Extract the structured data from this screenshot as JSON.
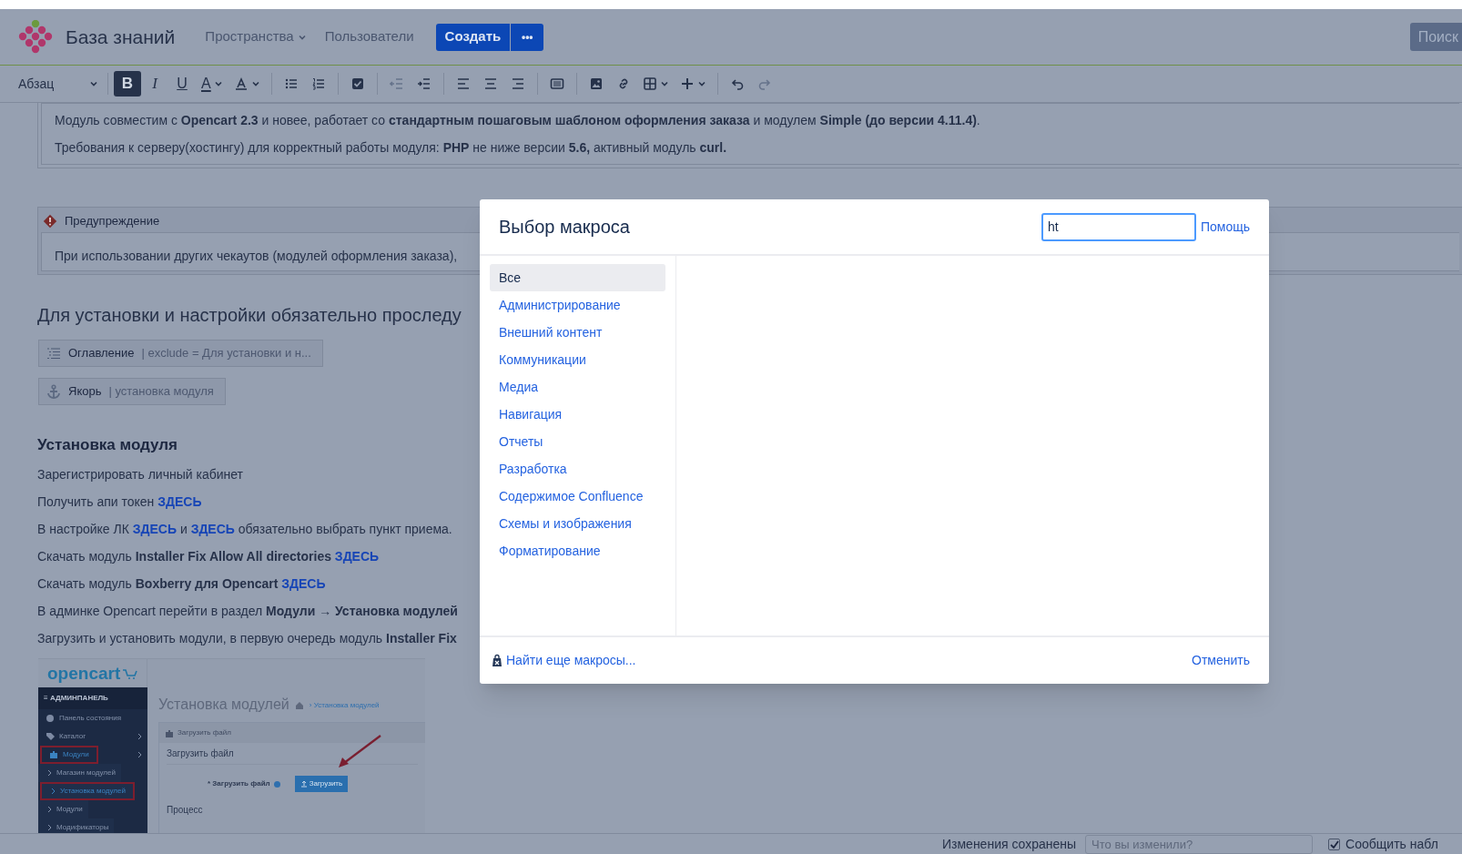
{
  "header": {
    "brand": "База знаний",
    "nav": [
      {
        "label": "Пространства",
        "dropdown": true
      },
      {
        "label": "Пользователи",
        "dropdown": false
      }
    ],
    "create_button": "Создать",
    "more_button": "•••",
    "search_button": "Поиск"
  },
  "toolbar": {
    "paragraph_style": "Абзац",
    "groups": [
      [
        {
          "kind": "bold",
          "label": "B",
          "selected": true,
          "disabled": false,
          "dropdown": false
        },
        {
          "kind": "italic",
          "label": "I",
          "selected": false,
          "disabled": false,
          "dropdown": false
        },
        {
          "kind": "underline",
          "label": "U",
          "selected": false,
          "disabled": false,
          "dropdown": false
        },
        {
          "kind": "text-color",
          "label": "A",
          "selected": false,
          "disabled": false,
          "dropdown": true
        },
        {
          "kind": "text-style",
          "selected": false,
          "disabled": false,
          "dropdown": true
        }
      ],
      [
        {
          "kind": "bullet-list",
          "selected": false,
          "disabled": false,
          "dropdown": false
        },
        {
          "kind": "numbered-list",
          "selected": false,
          "disabled": false,
          "dropdown": false
        }
      ],
      [
        {
          "kind": "task",
          "selected": false,
          "disabled": false,
          "dropdown": false
        }
      ],
      [
        {
          "kind": "outdent",
          "selected": false,
          "disabled": true,
          "dropdown": false
        },
        {
          "kind": "indent",
          "selected": false,
          "disabled": false,
          "dropdown": false
        }
      ],
      [
        {
          "kind": "align-left",
          "selected": false,
          "disabled": false,
          "dropdown": false
        },
        {
          "kind": "align-center",
          "selected": false,
          "disabled": false,
          "dropdown": false
        },
        {
          "kind": "align-right",
          "selected": false,
          "disabled": false,
          "dropdown": false
        }
      ],
      [
        {
          "kind": "layout",
          "selected": false,
          "disabled": false,
          "dropdown": false
        }
      ],
      [
        {
          "kind": "image",
          "selected": false,
          "disabled": false,
          "dropdown": false
        },
        {
          "kind": "link",
          "selected": false,
          "disabled": false,
          "dropdown": false
        },
        {
          "kind": "table",
          "selected": false,
          "disabled": false,
          "dropdown": true
        },
        {
          "kind": "insert",
          "selected": false,
          "disabled": false,
          "dropdown": true
        }
      ],
      [
        {
          "kind": "undo",
          "selected": false,
          "disabled": false,
          "dropdown": false
        },
        {
          "kind": "redo",
          "selected": false,
          "disabled": true,
          "dropdown": false
        }
      ]
    ]
  },
  "info_panel": {
    "lines": [
      "Модуль совместим с **Opencart 2.3** и новее, работает со **стандартным пошаговым шаблоном оформления заказа** и модулем **Simple (до версии 4.11.4)**.",
      "Требования к серверу(хостингу) для корректный работы модуля: **PHP** не ниже версии **5.6,** активный модуль **curl.**"
    ]
  },
  "warning_panel": {
    "title": "Предупреждение",
    "body": "При использовании других чекаутов (модулей оформления заказа),"
  },
  "heading": "Для установки и настройки обязательно проследу",
  "macros": [
    {
      "kind": "toc",
      "name": "Оглавление",
      "params": "| exclude = Для установки и н..."
    },
    {
      "kind": "anchor",
      "name": "Якорь",
      "params": "| установка модуля"
    }
  ],
  "section_title": "Установка модуля",
  "paragraphs": [
    [
      {
        "text": "Зарегистрировать личный кабинет"
      }
    ],
    [
      {
        "text": "Получить апи токен "
      },
      {
        "link": "ЗДЕСЬ"
      }
    ],
    [
      {
        "text": "В настройке ЛК "
      },
      {
        "link": "ЗДЕСЬ"
      },
      {
        "text": " и "
      },
      {
        "link": "ЗДЕСЬ"
      },
      {
        "text": " обязательно выбрать пункт приема."
      }
    ],
    [
      {
        "text": "Скачать модуль **Installer Fix Allow All directories** "
      },
      {
        "link": "ЗДЕСЬ"
      }
    ],
    [
      {
        "text": "Скачать модуль **Boxberry для Opencart** "
      },
      {
        "link": "ЗДЕСЬ"
      }
    ],
    [
      {
        "text": "В админке Opencart перейти в раздел **Модули → Установка модулей**"
      }
    ],
    [
      {
        "text": "Загрузить и установить модули, в первую очередь модуль **Installer Fix**"
      }
    ]
  ],
  "embedded_screenshot": {
    "logo": "opencart",
    "sidebar_title": "≡ АДМИНПАНЕЛЬ",
    "menu": [
      {
        "kind": "dashboard",
        "label": "Панель состояния",
        "expandable": false,
        "highlighted": false
      },
      {
        "kind": "catalog",
        "label": "Каталог",
        "expandable": true,
        "highlighted": false
      },
      {
        "kind": "modules",
        "label": "Модули",
        "expandable": true,
        "highlighted": true
      },
      {
        "kind": "sub",
        "label": "Магазин модулей",
        "expandable": false,
        "highlighted": false
      },
      {
        "kind": "sub",
        "label": "Установка модулей",
        "expandable": false,
        "highlighted": true
      },
      {
        "kind": "sub",
        "label": "Модули",
        "expandable": false,
        "highlighted": false
      },
      {
        "kind": "sub",
        "label": "Модификаторы",
        "expandable": false,
        "highlighted": false
      }
    ],
    "page_title": "Установка модулей",
    "breadcrumb": "› Установка модулей",
    "panel_title": "Загрузить файл",
    "form_title": "Загрузить файл",
    "field_label": "* Загрузить файл",
    "upload_button": "Загрузить",
    "progress_title": "Процесс"
  },
  "macro_dialog": {
    "title": "Выбор макроса",
    "search_value": "ht",
    "help_link": "Помощь",
    "categories": [
      {
        "label": "Все",
        "selected": true
      },
      {
        "label": "Администрирование",
        "selected": false
      },
      {
        "label": "Внешний контент",
        "selected": false
      },
      {
        "label": "Коммуникации",
        "selected": false
      },
      {
        "label": "Медиа",
        "selected": false
      },
      {
        "label": "Навигация",
        "selected": false
      },
      {
        "label": "Отчеты",
        "selected": false
      },
      {
        "label": "Разработка",
        "selected": false
      },
      {
        "label": "Содержимое Confluence",
        "selected": false
      },
      {
        "label": "Схемы и изображения",
        "selected": false
      },
      {
        "label": "Форматирование",
        "selected": false
      }
    ],
    "find_more_link": "Найти еще макросы...",
    "cancel_button": "Отменить"
  },
  "status_bar": {
    "status": "Изменения сохранены",
    "comment_placeholder": "Что вы изменили?",
    "notify_label": "Сообщить набл",
    "notify_checked": true
  }
}
